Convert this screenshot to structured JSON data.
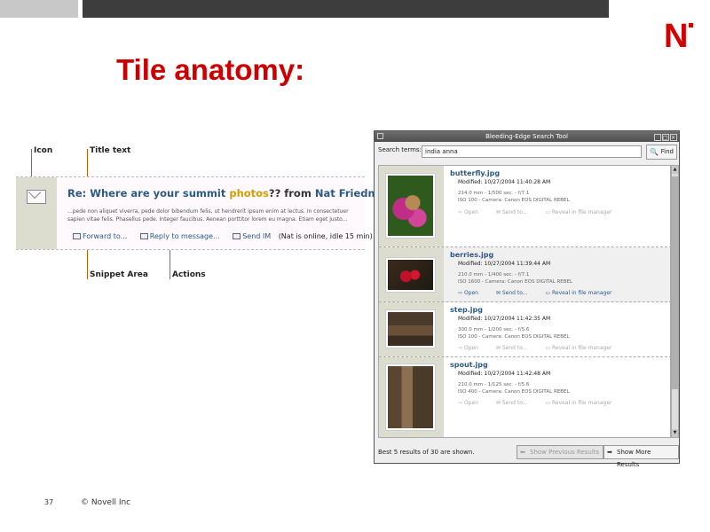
{
  "slide": {
    "title": "Tile anatomy:",
    "page_number": "37",
    "copyright": "© Novell Inc",
    "logo": "N",
    "brand_color": "#d40000"
  },
  "callouts": {
    "icon": "Icon",
    "title_text": "Title text",
    "snippet_area": "Snippet Area",
    "actions": "Actions"
  },
  "tile": {
    "title_prefix": "Re: Where are your summit ",
    "title_highlight": "photos",
    "title_mid": "?? from ",
    "title_name": "Nat Friedman",
    "snippet": "...pede non aliquet viverra, pede dolor bibendum felis, ut hendrerit ipsum enim at lectus. In consectetuer sapien vitae felis. Phasellus pede. Integer faucibus. Aenean porttitor lorem eu magna. Etiam eget justo...",
    "actions": {
      "forward": "Forward to...",
      "reply": "Reply to message...",
      "send_im": "Send IM",
      "im_status": "(Nat is online, idle 15 min)"
    }
  },
  "window": {
    "title": "Bleeding-Edge Search Tool",
    "search_label": "Search terms:",
    "search_value": "india anna",
    "find_label": "Find",
    "status": "Best 5 results of 30 are shown.",
    "prev_button": "Show Previous Results",
    "next_button": "Show More Results",
    "results": [
      {
        "filename": "butterfly.jpg",
        "modified": "Modified: 10/27/2004 11:40:28 AM",
        "meta1": "214.0 mm - 1/500 sec. - f/7.1",
        "meta2": "ISO 100 - Camera: Canon EOS DIGITAL REBEL",
        "open": "Open",
        "send": "Send to...",
        "reveal": "Reveal in file manager"
      },
      {
        "filename": "berries.jpg",
        "modified": "Modified: 10/27/2004 11:39:44 AM",
        "meta1": "210.0 mm - 1/400 sec. - f/7.1",
        "meta2": "ISO 1600 - Camera: Canon EOS DIGITAL REBEL",
        "open": "Open",
        "send": "Send to...",
        "reveal": "Reveal in file manager"
      },
      {
        "filename": "step.jpg",
        "modified": "Modified: 10/27/2004 11:42:35 AM",
        "meta1": "300.0 mm - 1/200 sec. - f/5.6",
        "meta2": "ISO 100 - Camera: Canon EOS DIGITAL REBEL",
        "open": "Open",
        "send": "Send to...",
        "reveal": "Reveal in file manager"
      },
      {
        "filename": "spout.jpg",
        "modified": "Modified: 10/27/2004 11:42:48 AM",
        "meta1": "210.0 mm - 1/125 sec. - f/5.6",
        "meta2": "ISO 400 - Camera: Canon EOS DIGITAL REBEL",
        "open": "Open",
        "send": "Send to...",
        "reveal": "Reveal in file manager"
      }
    ]
  }
}
